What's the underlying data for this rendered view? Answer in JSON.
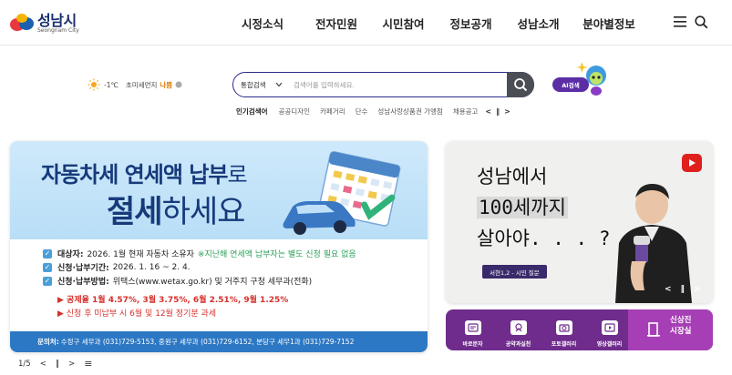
{
  "header": {
    "logo_title": "성남시",
    "logo_sub": "Seongnam City",
    "nav": [
      "시정소식",
      "전자민원",
      "시민참여",
      "정보공개",
      "성남소개",
      "분야별정보"
    ]
  },
  "weather": {
    "temp": "-1℃",
    "dust_label": "초미세먼지",
    "dust_value": "나쁨"
  },
  "search": {
    "category": "통합검색",
    "placeholder": "검색어를 입력하세요.",
    "ai_label": "AI검색"
  },
  "popular": {
    "title": "인기검색어",
    "keywords": [
      "공공디자인",
      "카페거리",
      "단수",
      "성남사랑상품권 가맹점",
      "채용공고"
    ],
    "prev": "<",
    "pause": "‖",
    "next": ">"
  },
  "banner": {
    "line1_bold": "자동차세 연세액 납부",
    "line1_light": "로",
    "line2_bold": "절세",
    "line2_light": "하세요",
    "rows": [
      {
        "label": "대상자:",
        "text": "2026. 1월 현재 자동차 소유자",
        "note": "※지난해 연세액 납부자는 별도 신청 필요 없음"
      },
      {
        "label": "신청·납부기간:",
        "text": "2026. 1. 16 ~ 2. 4.",
        "note": ""
      },
      {
        "label": "신청·납부방법:",
        "text": "위택스(www.wetax.go.kr) 및 거주지 구청 세무과(전화)",
        "note": ""
      }
    ],
    "red1": "▶ 공제율 1월 4.57%, 3월 3.75%, 6월 2.51%, 9월 1.25%",
    "red2": "▶ 신청 후 미납부 시 6월 및 12월 정기분 과세",
    "foot_label": "문의처:",
    "foot_text": "수정구 세무과 (031)729-5153, 중원구 세무과 (031)729-6152, 분당구 세무1과 (031)729-7152"
  },
  "pager": {
    "count": "1/5",
    "prev": "<",
    "pause": "‖",
    "next": ">",
    "all": "≡"
  },
  "video": {
    "line1": "성남에서",
    "line2": "100세까지",
    "line3": "살아야. . . ?",
    "caption": "서현1,2 - 시민 질문",
    "prev": "<",
    "pause": "‖",
    "next": ">"
  },
  "quick": {
    "items": [
      "바로문자",
      "공약과실천",
      "포토갤러리",
      "영상갤러리"
    ],
    "mayor_line1": "신상진",
    "mayor_line2": "시장실"
  },
  "colors": {
    "brand_navy": "#163a7a",
    "search_border": "#2b2b8a",
    "ai_purple": "#5b2ea6",
    "quick_purple": "#6f2c8c",
    "mayor_purple": "#a63fb5",
    "banner_blue": "#2d78c4",
    "alert_red": "#d6302b"
  }
}
